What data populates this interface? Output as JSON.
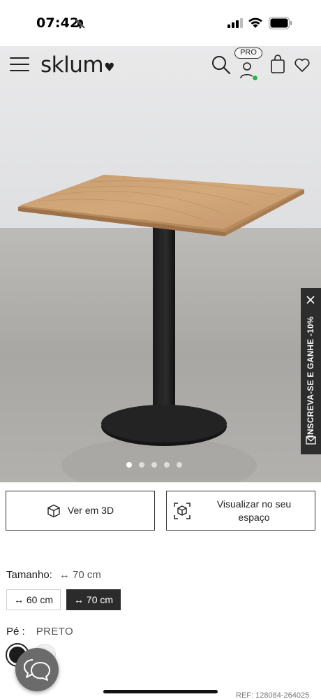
{
  "status_bar": {
    "time": "07:42"
  },
  "header": {
    "logo": "sklum",
    "pro_badge": "PRO"
  },
  "carousel": {
    "total": 5,
    "active_index": 0
  },
  "side_tab": {
    "label": "INSCREVA-SE E GANHE -10%"
  },
  "actions": {
    "view_3d_label": "Ver em 3D",
    "view_ar_label": "Visualizar no seu espaço"
  },
  "size": {
    "label": "Tamanho:",
    "selected_value": "↔ 70 cm",
    "options": [
      "↔ 60 cm",
      "↔ 70 cm"
    ],
    "selected_index": 1
  },
  "foot": {
    "label": "Pé :",
    "selected_value": "PRETO"
  },
  "ref": "REF: 128084-264025",
  "colors": {
    "accent": "#2b2b2b",
    "status_online": "#2bb24c",
    "side_tab_bg": "#2d2d2d"
  }
}
